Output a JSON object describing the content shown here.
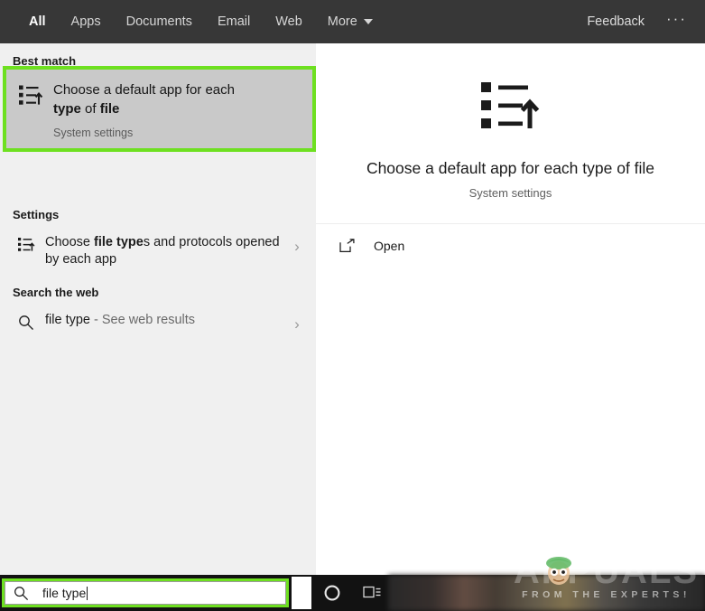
{
  "header": {
    "nav_items": [
      {
        "label": "All",
        "active": true
      },
      {
        "label": "Apps",
        "active": false
      },
      {
        "label": "Documents",
        "active": false
      },
      {
        "label": "Email",
        "active": false
      },
      {
        "label": "Web",
        "active": false
      },
      {
        "label": "More",
        "active": false
      }
    ],
    "feedback_label": "Feedback",
    "overflow_label": "···",
    "background_color": "#373737"
  },
  "left_panel": {
    "best_match": {
      "section_label": "Best match",
      "icon": "default-apps-list-icon",
      "title_parts": [
        {
          "text": "Choose a default app for each ",
          "bold": false
        },
        {
          "text": "type",
          "bold": true
        },
        {
          "text": " of ",
          "bold": false
        },
        {
          "text": "file",
          "bold": true
        }
      ],
      "subtitle": "System settings",
      "highlight_color": "#6ee020",
      "selected_background": "#c9c9c9"
    },
    "settings": {
      "section_label": "Settings",
      "items": [
        {
          "icon": "default-apps-list-icon",
          "title_parts": [
            {
              "text": "Choose ",
              "bold": false
            },
            {
              "text": "file type",
              "bold": true
            },
            {
              "text": "s and protocols opened by each app",
              "bold": false
            }
          ],
          "chevron": "chevron-right-icon"
        }
      ]
    },
    "search_the_web": {
      "section_label": "Search the web",
      "items": [
        {
          "icon": "search-icon",
          "query": "file type",
          "suffix": " - See web results",
          "chevron": "chevron-right-icon"
        }
      ]
    }
  },
  "right_panel": {
    "preview": {
      "icon": "default-apps-list-icon",
      "title": "Choose a default app for each type of file",
      "subtitle": "System settings"
    },
    "actions": [
      {
        "icon": "open-external-icon",
        "label": "Open"
      }
    ]
  },
  "taskbar": {
    "search_box": {
      "icon": "search-icon",
      "value": "file type",
      "highlight_color": "#6ee020"
    },
    "icons": [
      {
        "name": "cortana-icon"
      },
      {
        "name": "task-view-icon"
      }
    ]
  },
  "watermark": {
    "title": "APPUALS",
    "tagline": "FROM THE EXPERTS!"
  }
}
